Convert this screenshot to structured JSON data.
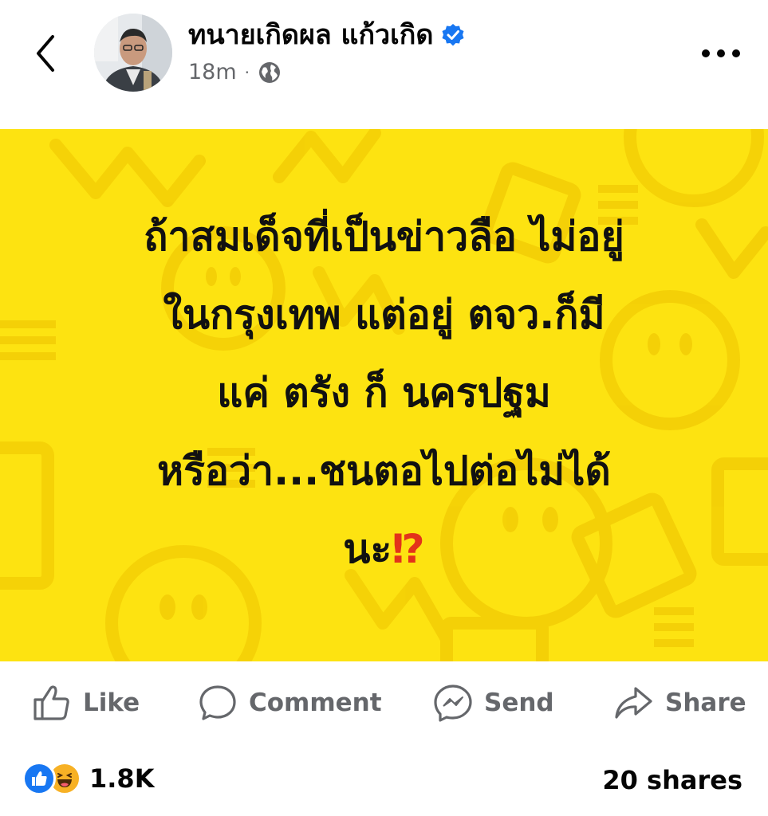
{
  "header": {
    "author_name": "ทนายเกิดผล แก้วเกิด",
    "timestamp": "18m",
    "separator": "·",
    "audience_icon": "globe-icon",
    "verified_icon": "verified-badge-icon"
  },
  "post": {
    "lines": [
      "ถ้าสมเด็จที่เป็นข่าวลือ ไม่อยู่",
      "ในกรุงเทพ แต่อยู่ ตจว.ก็มี",
      "แค่ ตรัง ก็ นครปฐม",
      "หรือว่า...ชนตอไปต่อไม่ได้",
      "นะ"
    ],
    "end_mark": "⁉",
    "background_color": "#fde311",
    "text_color": "#111111",
    "accent_color": "#e3331a"
  },
  "actions": {
    "like": "Like",
    "comment": "Comment",
    "send": "Send",
    "share": "Share"
  },
  "footer": {
    "reaction_count": "1.8K",
    "shares_label": "20 shares",
    "reaction_icons": [
      "like-reaction-icon",
      "haha-reaction-icon"
    ]
  }
}
